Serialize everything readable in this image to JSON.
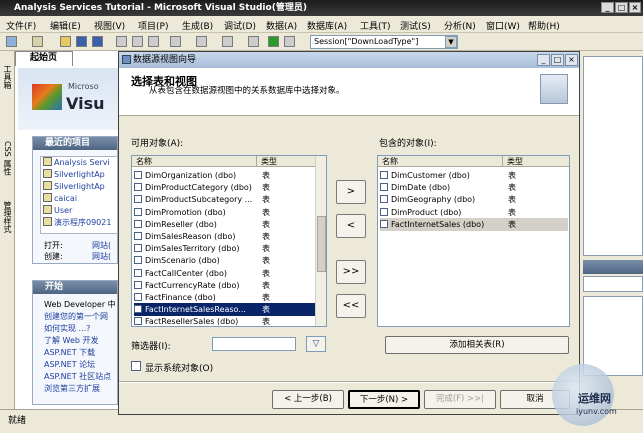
{
  "window": {
    "title": "Analysis Services Tutorial - Microsoft Visual Studio(管理员)"
  },
  "menu": [
    "文件(F)",
    "编辑(E)",
    "视图(V)",
    "项目(P)",
    "生成(B)",
    "调试(D)",
    "数据(A)",
    "数据库(A)",
    "工具(T)",
    "测试(S)",
    "分析(N)",
    "窗口(W)",
    "帮助(H)"
  ],
  "toolbar": {
    "combo_value": "Session[\"DownLoadType\"]"
  },
  "sidestrip": [
    "工具箱",
    "CSS 属性",
    "管理样式"
  ],
  "startpage": {
    "tab_label": "起始页",
    "logo_text": "Microso",
    "logo_text2": "Visu",
    "recent_title": "最近的项目",
    "recent_items": [
      "Analysis Servi",
      "SilverlightAp",
      "SilverlightAp",
      "caicai",
      "User",
      "演示程序09021"
    ],
    "open_label": "打开:",
    "open_link": "网站(",
    "create_label": "创建:",
    "create_link": "网站(",
    "start_title": "开始",
    "start_items": [
      "Web Developer 中",
      "创建您的第一个网",
      "如何实现 ...?",
      "了解 Web 开发",
      "ASP.NET 下载",
      "ASP.NET 论坛",
      "ASP.NET 社区站点",
      "浏览第三方扩展"
    ]
  },
  "dialog": {
    "title": "数据源视图向导",
    "heading": "选择表和视图",
    "description": "从表包含在数据源视图中的关系数据库中选择对象。",
    "available_label": "可用对象(A):",
    "included_label": "包含的对象(I):",
    "col_name": "名称",
    "col_type": "类型",
    "available_items": [
      {
        "name": "DimOrganization (dbo)",
        "type": "表"
      },
      {
        "name": "DimProductCategory (dbo)",
        "type": "表"
      },
      {
        "name": "DimProductSubcategory ...",
        "type": "表"
      },
      {
        "name": "DimPromotion (dbo)",
        "type": "表"
      },
      {
        "name": "DimReseller (dbo)",
        "type": "表"
      },
      {
        "name": "DimSalesReason (dbo)",
        "type": "表"
      },
      {
        "name": "DimSalesTerritory (dbo)",
        "type": "表"
      },
      {
        "name": "DimScenario (dbo)",
        "type": "表"
      },
      {
        "name": "FactCallCenter (dbo)",
        "type": "表"
      },
      {
        "name": "FactCurrencyRate (dbo)",
        "type": "表"
      },
      {
        "name": "FactFinance (dbo)",
        "type": "表"
      },
      {
        "name": "FactInternetSalesReaso...",
        "type": "表"
      },
      {
        "name": "FactResellerSales (dbo)",
        "type": "表"
      }
    ],
    "available_selected_index": 11,
    "included_items": [
      {
        "name": "DimCustomer (dbo)",
        "type": "表"
      },
      {
        "name": "DimDate (dbo)",
        "type": "表"
      },
      {
        "name": "DimGeography (dbo)",
        "type": "表"
      },
      {
        "name": "DimProduct (dbo)",
        "type": "表"
      },
      {
        "name": "FactInternetSales (dbo)",
        "type": "表"
      }
    ],
    "move_right": ">",
    "move_left": "<",
    "move_all_right": ">>",
    "move_all_left": "<<",
    "filter_label": "筛选器(I):",
    "filter_value": "",
    "add_related_label": "添加相关表(R)",
    "show_system_label": "显示系统对象(O)",
    "back_label": "< 上一步(B)",
    "next_label": "下一步(N) >",
    "finish_label": "完成(F) >>|",
    "cancel_label": "取消"
  },
  "status": {
    "text": "就绪"
  },
  "watermark": {
    "text": "运维网",
    "url": "iyunv.com"
  }
}
